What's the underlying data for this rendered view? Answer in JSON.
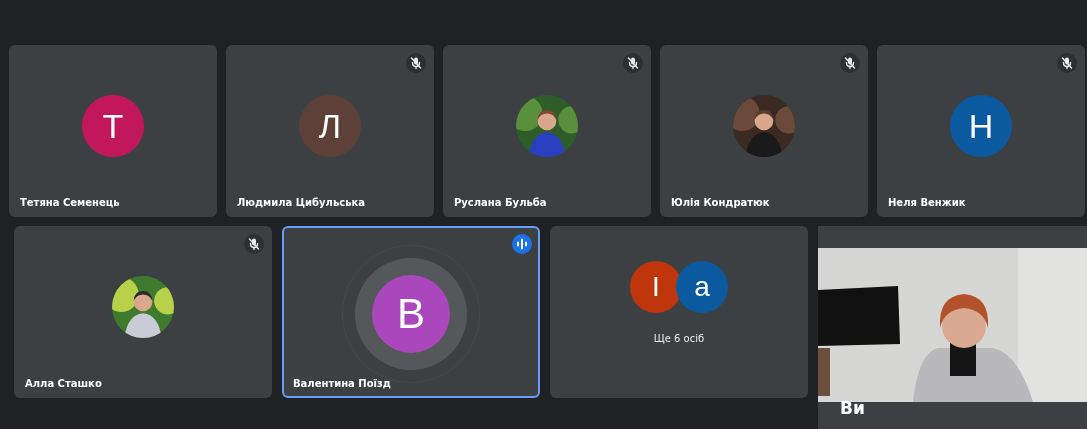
{
  "rows": [
    {
      "tiles": [
        {
          "name": "Тетяна Семенець",
          "avatar": {
            "kind": "letter",
            "letter": "Т",
            "color": "#c2185b"
          },
          "muted": false,
          "speaking": false
        },
        {
          "name": "Людмила Цибульська",
          "avatar": {
            "kind": "letter",
            "letter": "Л",
            "color": "#5d4037"
          },
          "muted": true,
          "speaking": false
        },
        {
          "name": "Руслана Бульба",
          "muted": true,
          "speaking": false
        },
        {
          "name": "Юлія Кондратюк",
          "muted": true,
          "speaking": false
        },
        {
          "name": "Неля Венжик",
          "avatar": {
            "kind": "letter",
            "letter": "Н",
            "color": "#0b5aa0"
          },
          "muted": true,
          "speaking": false
        }
      ]
    },
    {
      "tiles": [
        {
          "name": "Алла Сташко",
          "muted": true,
          "speaking": false
        },
        {
          "name": "Валентина Поїзд",
          "avatar": {
            "kind": "letter",
            "letter": "В",
            "color": "#ab47bc"
          },
          "muted": false,
          "speaking": true
        }
      ]
    }
  ],
  "overflow_tile": {
    "avatars": [
      {
        "letter": "І",
        "color": "#bf360c"
      },
      {
        "letter": "a",
        "color": "#0b5aa0"
      }
    ],
    "label": "Ще 6 осіб"
  },
  "self_view": {
    "label": "Ви"
  }
}
